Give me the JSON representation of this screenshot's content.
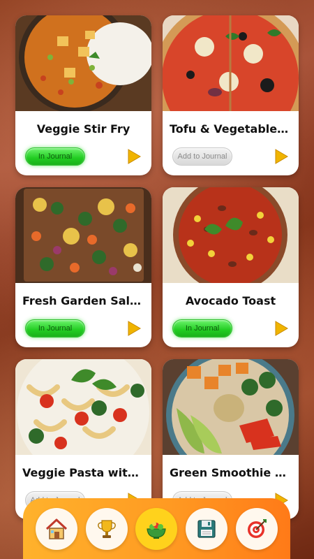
{
  "recipes": [
    {
      "title": "Veggie Stir Fry",
      "status": "In Journal",
      "in_journal": true
    },
    {
      "title": "Tofu & Vegetable ...",
      "status": "Add to Journal",
      "in_journal": false
    },
    {
      "title": "Fresh Garden Salad",
      "status": "In Journal",
      "in_journal": true
    },
    {
      "title": "Avocado Toast",
      "status": "In Journal",
      "in_journal": true
    },
    {
      "title": "Veggie Pasta with ...",
      "status": "Add to Journal",
      "in_journal": false
    },
    {
      "title": "Green Smoothie B...",
      "status": "Add to Journal",
      "in_journal": false
    }
  ],
  "nav": {
    "items": [
      {
        "icon": "home-icon"
      },
      {
        "icon": "trophy-icon"
      },
      {
        "icon": "salad-bowl-icon",
        "active": true
      },
      {
        "icon": "floppy-disk-icon"
      },
      {
        "icon": "target-icon"
      }
    ]
  },
  "colors": {
    "in_journal": "#21cc21",
    "add_to_journal": "#d8d8d8",
    "play_arrow": "#f0b400",
    "bottom_bar": "#ff9a22",
    "active_nav": "#ffd21c"
  }
}
